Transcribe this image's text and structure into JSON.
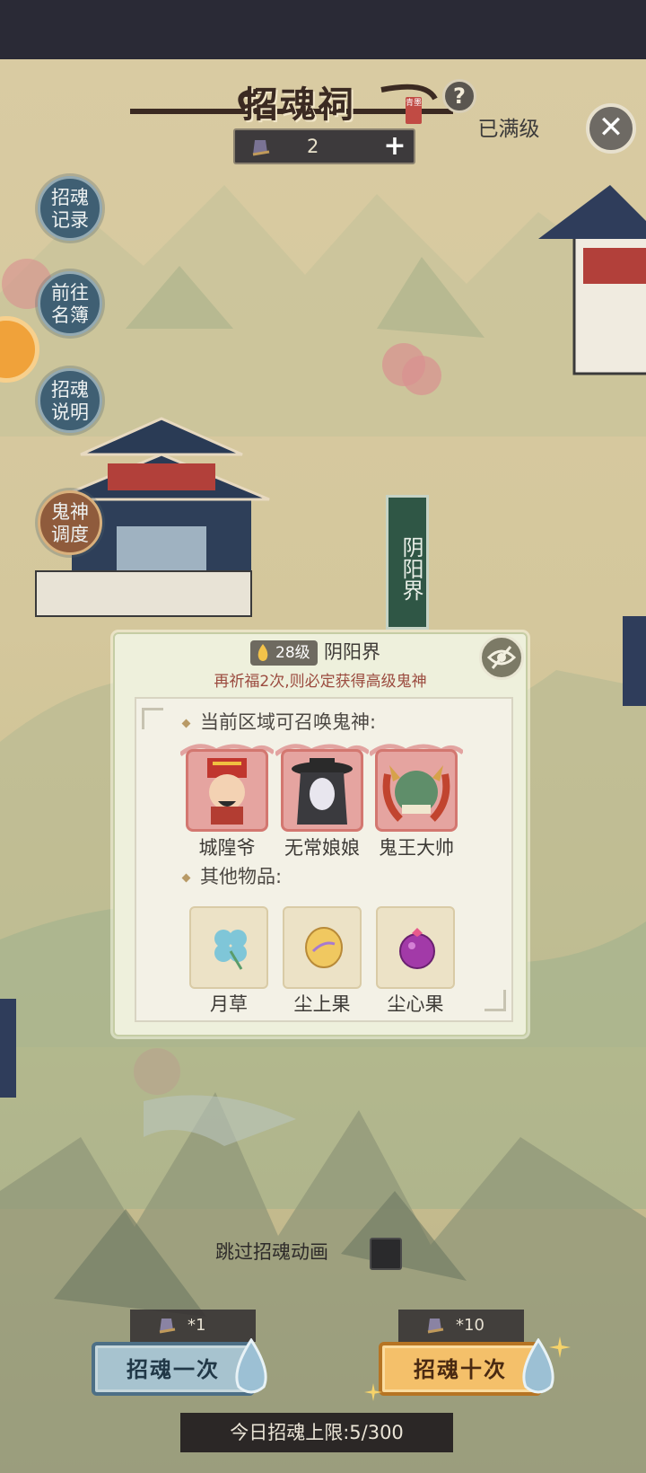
{
  "header": {
    "title": "招魂祠",
    "seal_text": "青墨",
    "help_icon": "question-icon",
    "max_level_label": "已满级",
    "close_icon": "close-icon",
    "ticket_count": "2",
    "add_icon": "plus-icon"
  },
  "side_menu": [
    {
      "label": "招魂\n记录"
    },
    {
      "label": "前往\n名簿"
    },
    {
      "label": "招魂\n说明"
    },
    {
      "label": "鬼神\n调度"
    }
  ],
  "map_sign": "阴阳界",
  "panel": {
    "level": "28级",
    "title": "阴阳界",
    "subtitle": "再祈福2次,则必定获得高级鬼神",
    "section_gods": "当前区域可召唤鬼神:",
    "gods": [
      {
        "name": "城隍爷",
        "icon": "city-god-portrait"
      },
      {
        "name": "无常娘娘",
        "icon": "wuchang-lady-portrait"
      },
      {
        "name": "鬼王大帅",
        "icon": "ghost-king-portrait"
      }
    ],
    "section_items": "其他物品:",
    "items": [
      {
        "name": "月草",
        "icon": "clover-icon"
      },
      {
        "name": "尘上果",
        "icon": "golden-fruit-icon"
      },
      {
        "name": "尘心果",
        "icon": "purple-fruit-icon"
      }
    ]
  },
  "bottom": {
    "skip_label": "跳过招魂动画",
    "summon_one": {
      "cost": "*1",
      "label": "招魂一次"
    },
    "summon_ten": {
      "cost": "*10",
      "label": "招魂十次"
    },
    "daily_limit": "今日招魂上限:5/300"
  },
  "colors": {
    "map_bg": "#d8c9a0",
    "sign_green": "#2f5645",
    "panel_bg": "#eef0dc",
    "summon_one_blue": "#a7c3cf",
    "summon_ten_gold": "#f4c06a",
    "subtitle_red": "#9b4b3f"
  }
}
